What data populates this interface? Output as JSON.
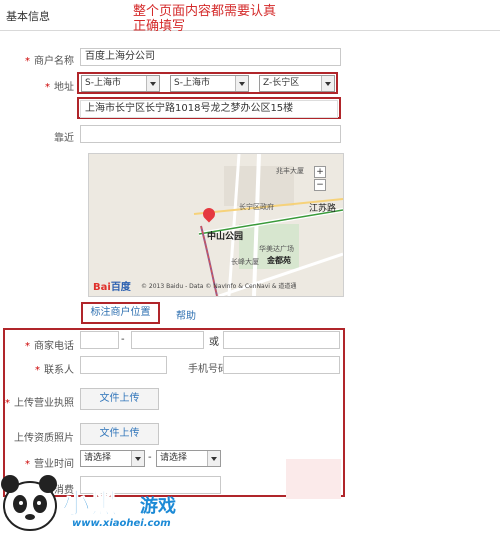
{
  "header": {
    "tab": "基本信息"
  },
  "notice": {
    "line1": "整个页面内容都需要认真",
    "line2": "正确填写"
  },
  "form": {
    "merchant_name": {
      "label": "商户名称",
      "value": "百度上海分公司"
    },
    "address": {
      "label": "地址",
      "province": "S-上海市",
      "city": "S-上海市",
      "district": "Z-长宁区",
      "detail": "上海市长宁区长宁路1018号龙之梦办公区15楼"
    },
    "nearby": {
      "label": "靠近",
      "value": ""
    },
    "mark_location_button": "标注商户位置",
    "help_link": "帮助",
    "phone": {
      "label": "商家电话",
      "dash": "-",
      "or": "或"
    },
    "contact": {
      "label": "联系人",
      "mobile_label": "手机号码"
    },
    "license": {
      "label": "上传营业执照",
      "button": "文件上传"
    },
    "qualification": {
      "label": "上传资质照片",
      "button": "文件上传"
    },
    "hours": {
      "label": "营业时间",
      "start": "请选择",
      "dash": "-",
      "end": "请选择"
    },
    "avg_price": {
      "label": "人均消费"
    }
  },
  "map": {
    "labels": {
      "zhaofeng": "兆丰大厦",
      "changning_gov": "长宁区政府",
      "jiangsu": "江苏路",
      "zhongshan": "中山公园",
      "huamei": "华美达广场",
      "changfeng": "长峰大厦",
      "jindu": "金都苑"
    },
    "zoom_in": "+",
    "zoom_out": "−",
    "copyright": "© 2013 Baidu - Data © NavInfo & CenNavi & 道道通",
    "brand": "Bai",
    "brand2": "百度"
  },
  "watermark": {
    "name": "小黑",
    "sub": "游戏",
    "url": "www.xiaohei.com"
  }
}
